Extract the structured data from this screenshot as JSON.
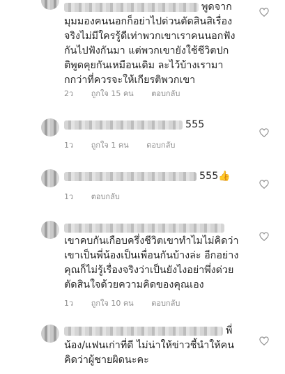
{
  "comments": [
    {
      "line1": "พูดจาก",
      "lines": [
        "มุมมองคนนอกก็อย่าไปด่วนตัดสินสิเรื่อง",
        "จริงไม่มีใครรู้ดีเท่าพวกเขาเราคนนอกฟัง",
        "กันไปฟังกันมา แต่พวกเขายังใช้ชีวิตปก",
        "ติพูดคุยกันเหมือนเดิม ละไว้บ้างเรามา",
        "กกว่าที่ควรจะให้เกียรติพวกเขา"
      ],
      "time": "2ว",
      "likes": "ถูกใจ 15 คน",
      "reply": "ตอบกลับ"
    },
    {
      "inline": "555",
      "time": "1ว",
      "likes": "ถูกใจ 1 คน",
      "reply": "ตอบกลับ"
    },
    {
      "inline": "555",
      "emoji": "👍",
      "time": "1ว",
      "reply": "ตอบกลับ"
    },
    {
      "lines": [
        "เขาคบกันเกือบครึ่งชีวิตเขาทำไมไม่คิดว่า",
        "เขาเป็นพี่น้องเป็นเพื่อนกันบ้างล่ะ อีกอย่าง",
        "คุณก็ไม่รู้เรื่องจริงว่าเป็นยังไงอย่าพึ่งด่วย",
        "ตัดสินใจด้วยความคิดของคุณเอง"
      ],
      "time": "1ว",
      "likes": "ถูกใจ 10 คน",
      "reply": "ตอบกลับ"
    },
    {
      "line1": "พี่",
      "lines": [
        "น้อง/แฟนเก่าที่ดี ไม่น่าให้ข่าวชี้นำให้คน",
        "คิดว่าผู้ชายผิดนะคะ"
      ]
    }
  ]
}
